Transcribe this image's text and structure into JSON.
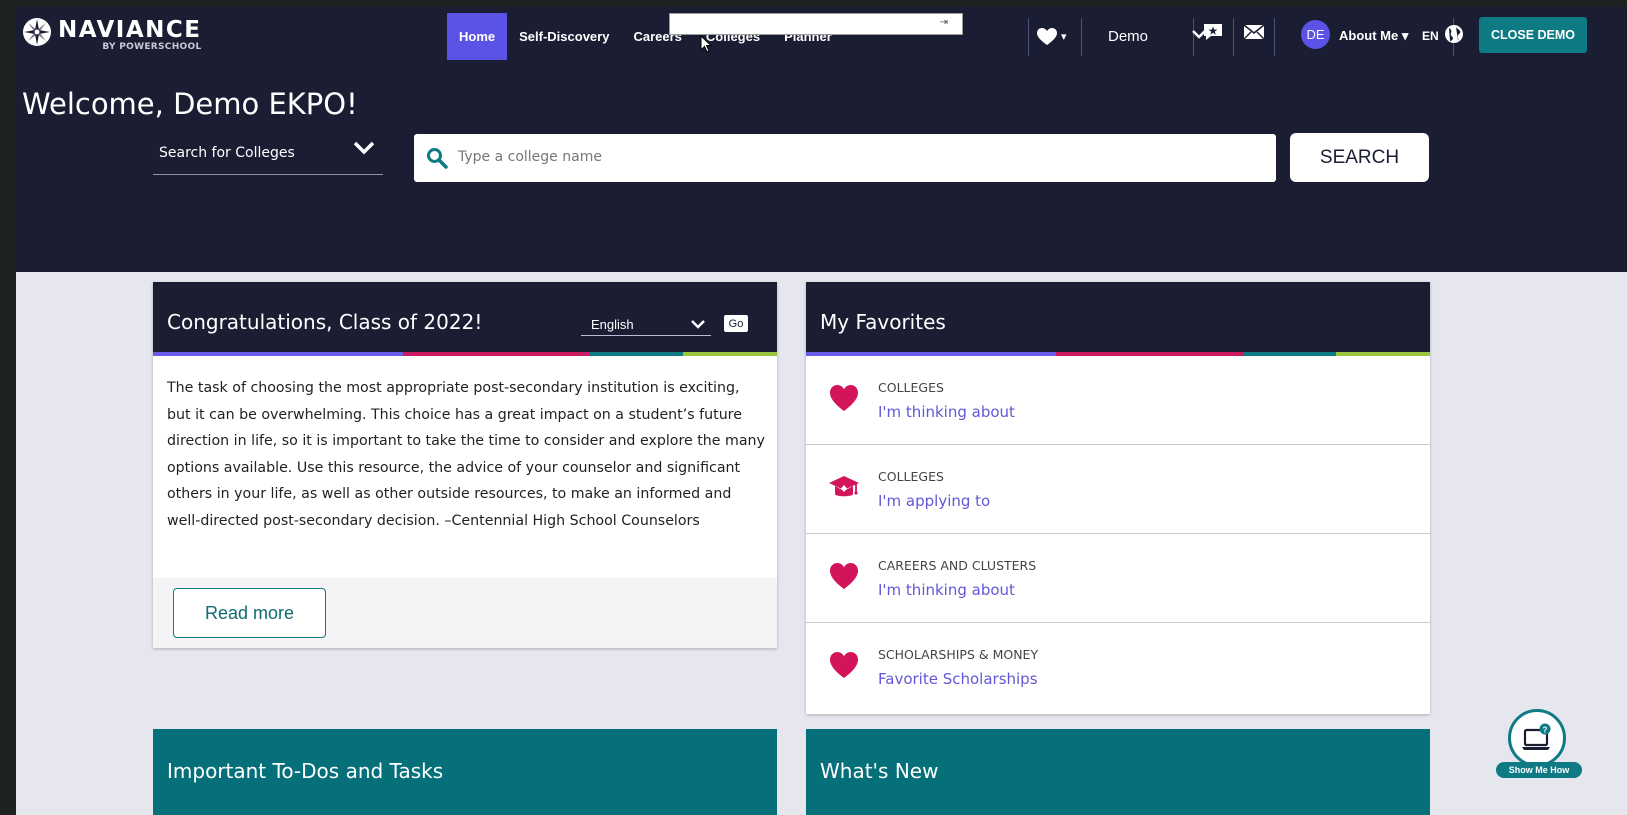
{
  "brand": {
    "name": "NAVIANCE",
    "sub": "BY POWERSCHOOL"
  },
  "nav": {
    "items": [
      {
        "label": "Home",
        "active": true
      },
      {
        "label": "Self-Discovery",
        "active": false
      },
      {
        "label": "Careers",
        "active": false
      },
      {
        "label": "Colleges",
        "active": false
      },
      {
        "label": "Planner",
        "active": false
      }
    ]
  },
  "header": {
    "demo_select": "Demo",
    "avatar_initials": "DE",
    "about_label": "About Me ▾",
    "language": "EN",
    "close_demo": "CLOSE DEMO",
    "favorites_caret": "▾"
  },
  "hero": {
    "welcome": "Welcome, Demo EKPO!",
    "search_type": "Search for Colleges",
    "search_placeholder": "Type a college name",
    "search_button": "SEARCH"
  },
  "congrats_card": {
    "title": "Congratulations, Class of 2022!",
    "language_select": "English",
    "go_label": "Go",
    "body": "The task of choosing the most appropriate post-secondary institution is exciting, but it can be overwhelming. This choice has a great impact on a student’s future direction in life, so it is important to take the time to consider and explore the many options available. Use this resource, the advice of your counselor and significant others in your life, as well as other outside resources, to make an informed and well-directed post-secondary decision. –Centennial High School Counselors",
    "read_more": "Read more"
  },
  "favorites_card": {
    "title": "My Favorites",
    "items": [
      {
        "category": "COLLEGES",
        "link": "I'm thinking about",
        "icon": "heart-icon"
      },
      {
        "category": "COLLEGES",
        "link": "I'm applying to",
        "icon": "graduation-cap-icon"
      },
      {
        "category": "CAREERS AND CLUSTERS",
        "link": "I'm thinking about",
        "icon": "heart-icon"
      },
      {
        "category": "SCHOLARSHIPS & MONEY",
        "link": "Favorite Scholarships",
        "icon": "heart-icon"
      }
    ]
  },
  "todos_card": {
    "title": "Important To-Dos and Tasks"
  },
  "whats_new_card": {
    "title": "What's New"
  },
  "show_me_how": {
    "label": "Show Me How"
  },
  "colors": {
    "navy": "#1b1d33",
    "accent_purple": "#5a53e6",
    "teal": "#0e7a83",
    "heart_pink": "#d4145a",
    "link_purple": "#6258d6",
    "stripe": [
      "#6a5ce6",
      "#cc1a62",
      "#0e7a83",
      "#9bc53d"
    ]
  }
}
